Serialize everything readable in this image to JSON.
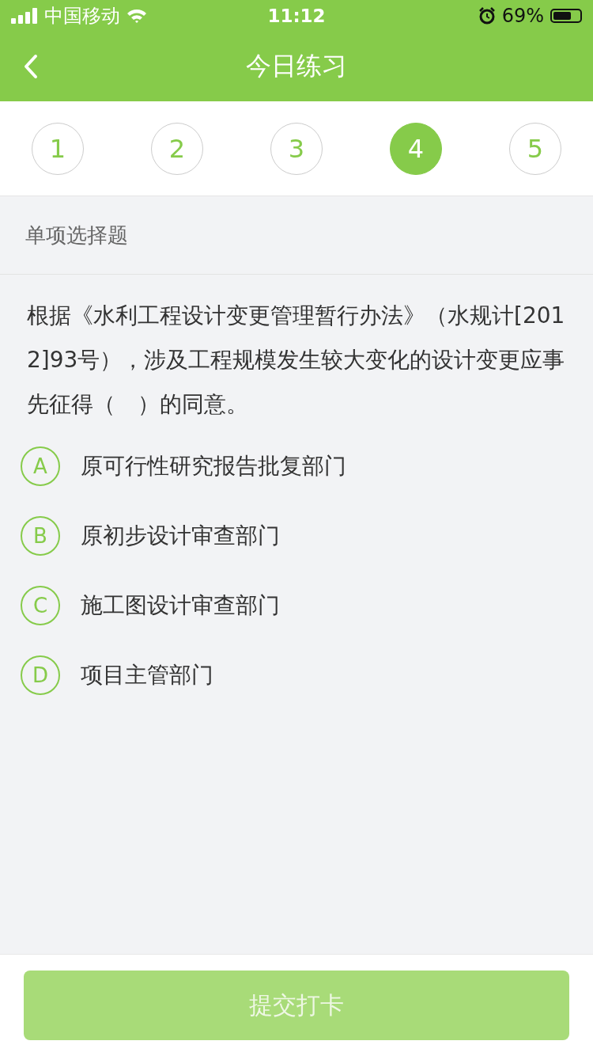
{
  "status_bar": {
    "carrier": "中国移动",
    "time": "11:12",
    "battery": "69%"
  },
  "nav": {
    "title": "今日练习"
  },
  "steps": [
    {
      "label": "1",
      "selected": false
    },
    {
      "label": "2",
      "selected": false
    },
    {
      "label": "3",
      "selected": false
    },
    {
      "label": "4",
      "selected": true
    },
    {
      "label": "5",
      "selected": false
    }
  ],
  "question_type": "单项选择题",
  "question": "根据《水利工程设计变更管理暂行办法》（水规计[2012]93号），涉及工程规模发生较大变化的设计变更应事先征得（　）的同意。",
  "options": [
    {
      "letter": "A",
      "text": "原可行性研究报告批复部门",
      "selected": false
    },
    {
      "letter": "B",
      "text": "原初步设计审查部门",
      "selected": false
    },
    {
      "letter": "C",
      "text": "施工图设计审查部门",
      "selected": false
    },
    {
      "letter": "D",
      "text": "项目主管部门",
      "selected": false
    }
  ],
  "submit": {
    "label": "提交打卡",
    "disabled": true
  }
}
